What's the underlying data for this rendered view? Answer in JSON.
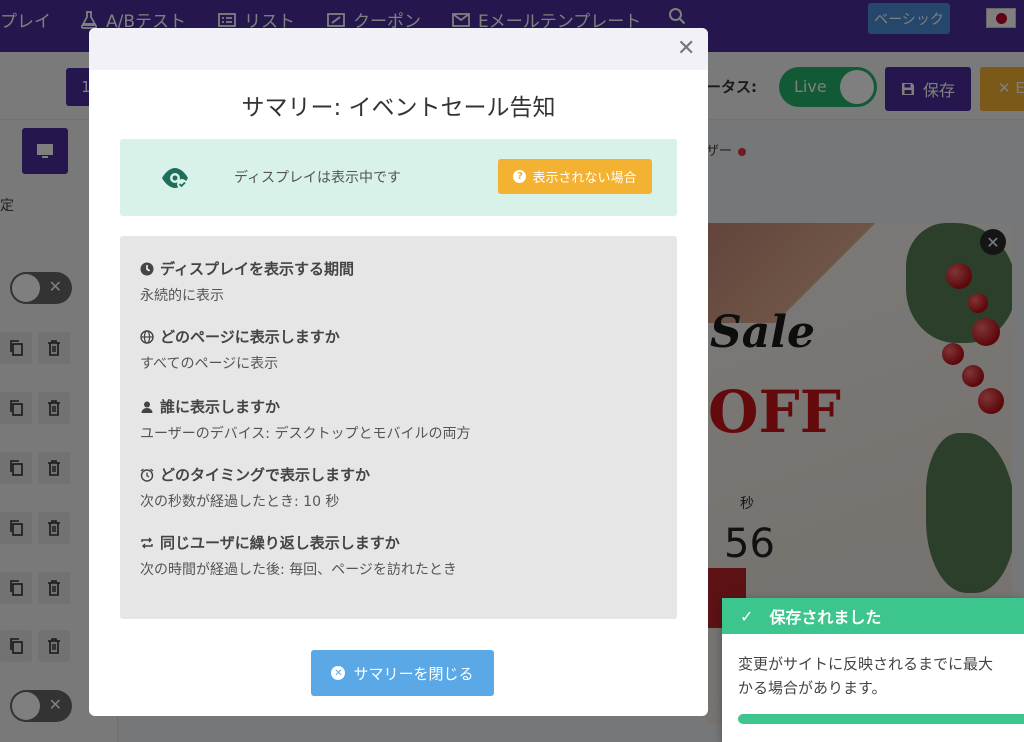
{
  "nav": {
    "items": [
      {
        "label": "プレイ",
        "icon": "none"
      },
      {
        "label": "A/Bテスト",
        "icon": "flask-icon"
      },
      {
        "label": "リスト",
        "icon": "list-icon"
      },
      {
        "label": "クーポン",
        "icon": "coupon-icon"
      },
      {
        "label": "Eメールテンプレート",
        "icon": "email-icon"
      }
    ],
    "plan_badge": "ベーシック"
  },
  "toolbar": {
    "number_label": "1",
    "status_label": "ータス:",
    "live_label": "Live",
    "save_label": "保存",
    "close_label": "E"
  },
  "sidebar": {
    "label": "定"
  },
  "editor": {
    "tab_label": "ザー"
  },
  "preview": {
    "sale_text": "Sale",
    "off_text": "OFF",
    "seconds_label": "秒",
    "seconds_value": "56"
  },
  "modal": {
    "title": "サマリー: イベントセール告知",
    "status_text": "ディスプレイは表示中です",
    "why_button": "表示されない場合",
    "items": [
      {
        "title": "ディスプレイを表示する期間",
        "desc": "永続的に表示",
        "icon": "clock-icon"
      },
      {
        "title": "どのページに表示しますか",
        "desc": "すべてのページに表示",
        "icon": "globe-icon"
      },
      {
        "title": "誰に表示しますか",
        "desc": "ユーザーのデバイス: デスクトップとモバイルの両方",
        "icon": "user-icon"
      },
      {
        "title": "どのタイミングで表示しますか",
        "desc": "次の秒数が経過したとき: 10 秒",
        "icon": "alarm-icon"
      },
      {
        "title": "同じユーザに繰り返し表示しますか",
        "desc": "次の時間が経過した後: 毎回、ページを訪れたとき",
        "icon": "repeat-icon"
      }
    ],
    "close_button": "サマリーを閉じる"
  },
  "toast": {
    "title": "保存されました",
    "message": "変更がサイトに反映されるまでに最大\nかる場合があります。"
  },
  "colors": {
    "brand": "#4b2e9a",
    "live": "#25b26a",
    "warning": "#f4b233",
    "info": "#5aa9e6",
    "success": "#3cc58c"
  }
}
